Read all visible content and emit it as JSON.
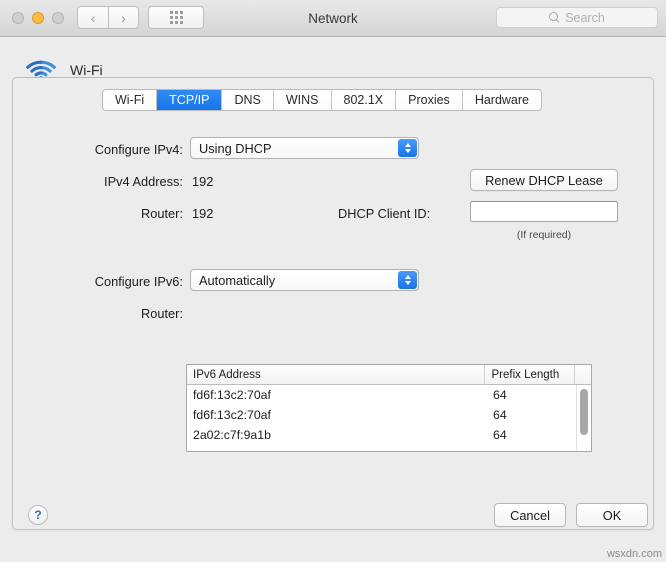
{
  "window": {
    "title": "Network",
    "traffic_lights": [
      "close",
      "minimize",
      "zoom"
    ],
    "nav_back": "‹",
    "nav_forward": "›",
    "grid_icon": "grid-icon"
  },
  "search": {
    "placeholder": "Search",
    "icon": "search-icon"
  },
  "service": {
    "icon": "wifi-icon",
    "name": "Wi-Fi"
  },
  "tabs": [
    {
      "label": "Wi-Fi",
      "active": false
    },
    {
      "label": "TCP/IP",
      "active": true
    },
    {
      "label": "DNS",
      "active": false
    },
    {
      "label": "WINS",
      "active": false
    },
    {
      "label": "802.1X",
      "active": false
    },
    {
      "label": "Proxies",
      "active": false
    },
    {
      "label": "Hardware",
      "active": false
    }
  ],
  "ipv4": {
    "configure_label": "Configure IPv4:",
    "configure_value": "Using DHCP",
    "address_label": "IPv4 Address:",
    "address_value": "192",
    "router_label": "Router:",
    "router_value": "192",
    "renew_button": "Renew DHCP Lease",
    "client_id_label": "DHCP Client ID:",
    "client_id_value": "",
    "client_id_hint": "(If required)"
  },
  "ipv6": {
    "configure_label": "Configure IPv6:",
    "configure_value": "Automatically",
    "router_label": "Router:",
    "router_value": "",
    "table": {
      "columns": [
        "IPv6 Address",
        "Prefix Length"
      ],
      "rows": [
        {
          "address": "fd6f:13c2:70af",
          "prefix": "64"
        },
        {
          "address": "fd6f:13c2:70af",
          "prefix": "64"
        },
        {
          "address": "2a02:c7f:9a1b",
          "prefix": "64"
        }
      ]
    }
  },
  "footer": {
    "help": "?",
    "cancel": "Cancel",
    "ok": "OK"
  },
  "watermark": "wsxdn.com",
  "colors": {
    "accent_blue": "#1874e8",
    "window_bg": "#ececec",
    "wifi_blue": "#2a7fd4"
  }
}
